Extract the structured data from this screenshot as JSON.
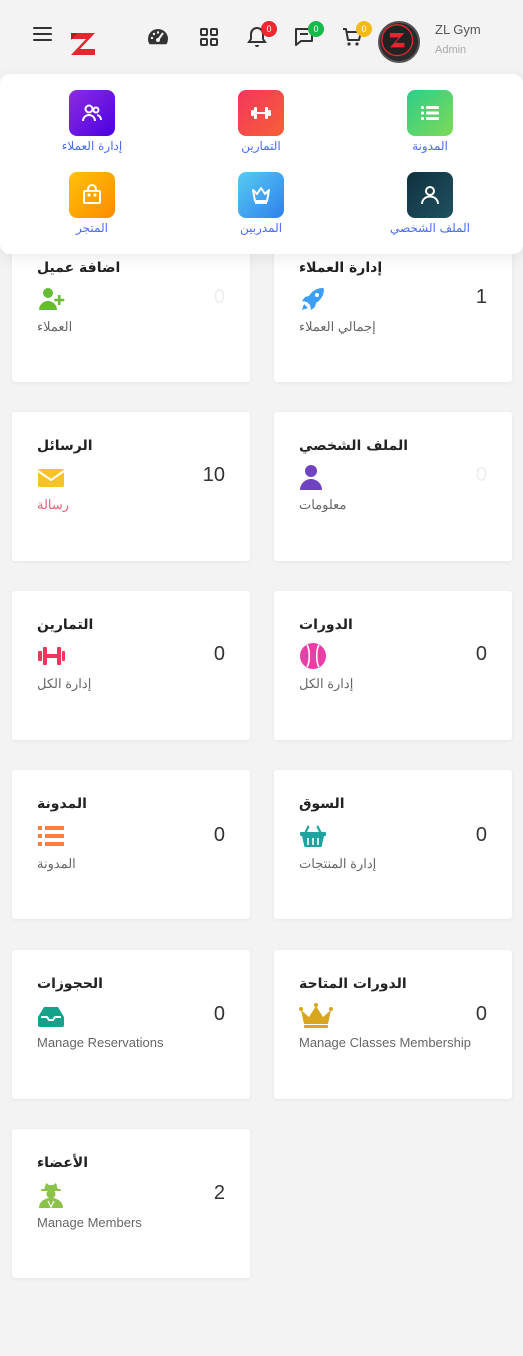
{
  "header": {
    "user_name": "ZL Gym",
    "user_role": "Admin",
    "notifications_count": "0",
    "messages_count": "0",
    "cart_count": "0"
  },
  "menu": {
    "items": [
      {
        "label": "إدارة العملاء",
        "icon": "users-icon",
        "color": "#8e2de2"
      },
      {
        "label": "التمارين",
        "icon": "dumbbell-icon",
        "color": "#f5365c"
      },
      {
        "label": "المدونة",
        "icon": "list-icon",
        "color": "#2dce89"
      },
      {
        "label": "المتجر",
        "icon": "shopping-bag-icon",
        "color": "#fb8c00"
      },
      {
        "label": "المدربين",
        "icon": "crown-icon",
        "color": "#3dafed"
      },
      {
        "label": "الملف الشخصي",
        "icon": "user-icon",
        "color": "#11313f"
      }
    ]
  },
  "cards": [
    {
      "title": "اضافة عميل",
      "value": "0",
      "subtitle": "العملاء",
      "icon": "user-plus-icon",
      "color": "#66bb33"
    },
    {
      "title": "إدارة العملاء",
      "value": "1",
      "subtitle": "إجمالي العملاء",
      "icon": "rocket-icon",
      "color": "#3d9ef5"
    },
    {
      "title": "الرسائل",
      "value": "10",
      "subtitle": "رسالة",
      "icon": "envelope-icon",
      "color": "#f7c325"
    },
    {
      "title": "الملف الشخصي",
      "value": "0",
      "subtitle": "معلومات",
      "icon": "user-icon",
      "color": "#6f42c1"
    },
    {
      "title": "التمارين",
      "value": "0",
      "subtitle": "إدارة الكل",
      "icon": "dumbbell-icon",
      "color": "#f5365c"
    },
    {
      "title": "الدورات",
      "value": "0",
      "subtitle": "إدارة الكل",
      "icon": "baseball-icon",
      "color": "#e83ea8"
    },
    {
      "title": "المدونة",
      "value": "0",
      "subtitle": "المدونة",
      "icon": "list-icon",
      "color": "#fd7e3c"
    },
    {
      "title": "السوق",
      "value": "0",
      "subtitle": "إدارة المنتجات",
      "icon": "basket-icon",
      "color": "#20a39e"
    },
    {
      "title": "الحجوزات",
      "value": "0",
      "subtitle": "Manage Reservations",
      "icon": "tray-icon",
      "color": "#13a38b"
    },
    {
      "title": "الدورات المتاحة",
      "value": "0",
      "subtitle": "Manage Classes Membership",
      "icon": "crown-icon",
      "color": "#d9a61f"
    },
    {
      "title": "الأعضاء",
      "value": "2",
      "subtitle": "Manage Members",
      "icon": "spy-user-icon",
      "color": "#8bc34a"
    }
  ]
}
